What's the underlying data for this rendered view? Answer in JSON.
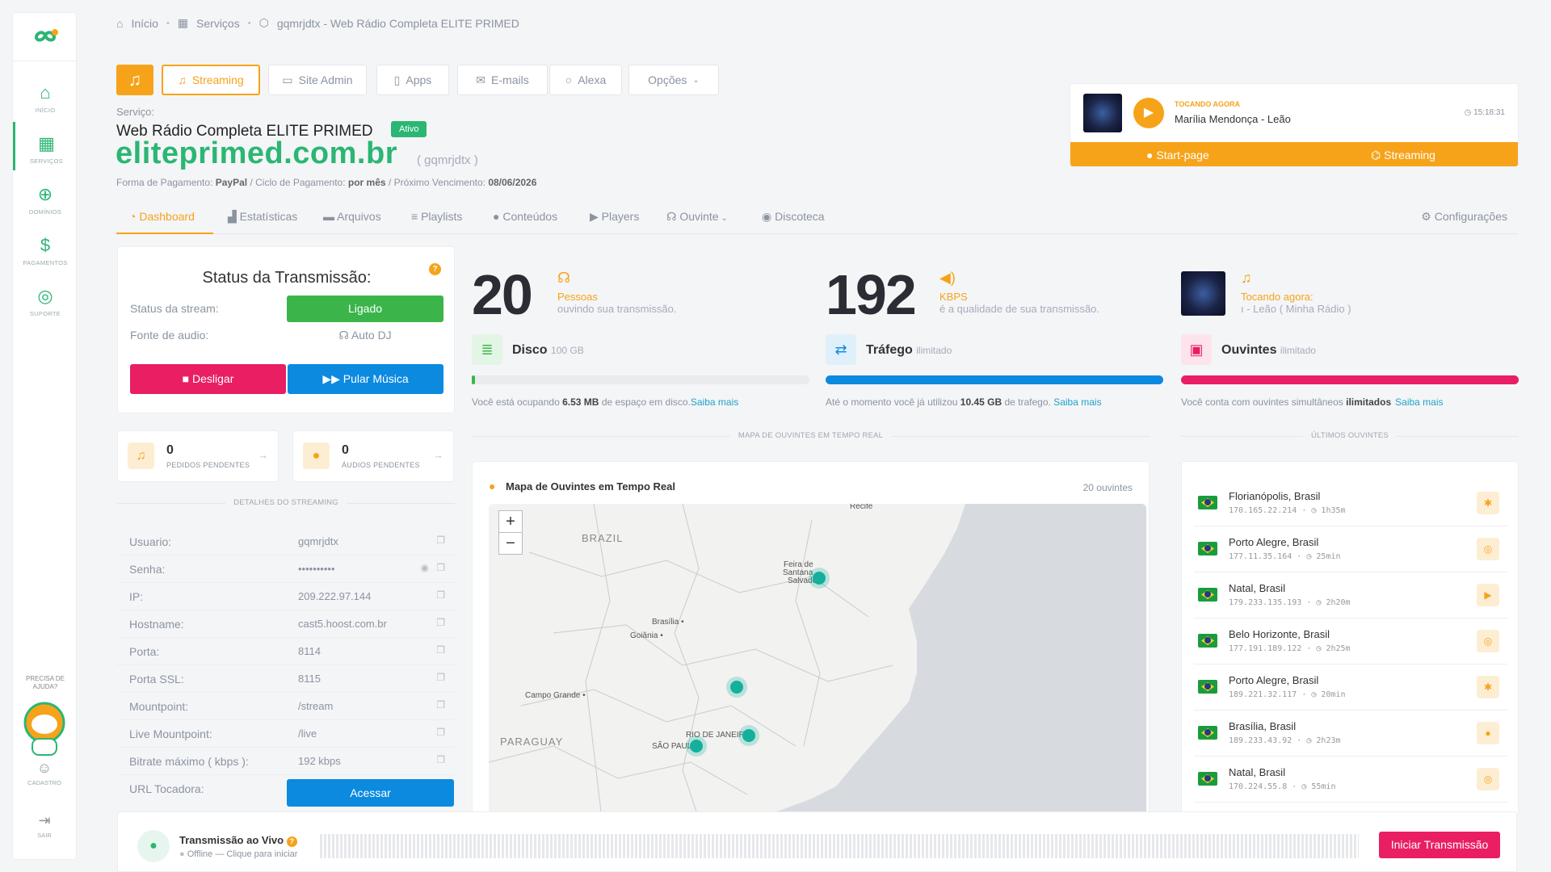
{
  "sidebar": {
    "items": [
      {
        "label": "INÍCIO",
        "icon": "home-icon"
      },
      {
        "label": "SERVIÇOS",
        "icon": "grid-icon"
      },
      {
        "label": "DOMÍNIOS",
        "icon": "globe-icon"
      },
      {
        "label": "PAGAMENTOS",
        "icon": "dollar-icon"
      },
      {
        "label": "SUPORTE",
        "icon": "lifebuoy-icon"
      }
    ],
    "help_line1": "PRECISA DE",
    "help_line2": "AJUDA?",
    "cadastro": "CADASTRO",
    "sair": "SAIR"
  },
  "breadcrumb": {
    "home": "Início",
    "services": "Serviços",
    "current": "gqmrjdtx - Web Rádio Completa ELITE PRIMED"
  },
  "toolbar": {
    "streaming": "Streaming",
    "site_admin": "Site Admin",
    "apps": "Apps",
    "emails": "E-mails",
    "alexa": "Alexa",
    "opcoes": "Opções"
  },
  "service": {
    "label": "Serviço:",
    "name": "Web Rádio Completa ELITE PRIMED",
    "status": "Ativo",
    "domain": "eliteprimed.com.br",
    "username": "( gqmrjdtx )",
    "pay_method_label": "Forma de Pagamento:",
    "pay_method": "PayPal",
    "cycle_label": "/ Ciclo de Pagamento:",
    "cycle": "por mês",
    "due_label": "/ Próximo Vencimento:",
    "due": "08/06/2026"
  },
  "now_playing": {
    "label": "TOCANDO AGORA",
    "song": "Marília Mendonça - Leão",
    "time": "15:18:31",
    "startpage": "Start-page",
    "streaming": "Streaming"
  },
  "tabs": [
    "Dashboard",
    "Estatísticas",
    "Arquivos",
    "Playlists",
    "Conteúdos",
    "Players",
    "Ouvinte",
    "Discoteca",
    "Configurações"
  ],
  "status": {
    "title": "Status da Transmissão:",
    "stream_label": "Status da stream:",
    "stream_value": "Ligado",
    "source_label": "Fonte de audio:",
    "source_value": "Auto DJ",
    "btn_off": "Desligar",
    "btn_skip": "Pular Música"
  },
  "pending": {
    "pedidos_count": "0",
    "pedidos_label": "PEDIDOS PENDENTES",
    "audios_count": "0",
    "audios_label": "ÁUDIOS PENDENTES"
  },
  "details": {
    "section_title": "DETALHES DO STREAMING",
    "rows": [
      {
        "k": "Usuario:",
        "v": "gqmrjdtx"
      },
      {
        "k": "Senha:",
        "v": "••••••••••"
      },
      {
        "k": "IP:",
        "v": "209.222.97.144"
      },
      {
        "k": "Hostname:",
        "v": "cast5.hoost.com.br"
      },
      {
        "k": "Porta:",
        "v": "8114"
      },
      {
        "k": "Porta SSL:",
        "v": "8115"
      },
      {
        "k": "Mountpoint:",
        "v": "/stream"
      },
      {
        "k": "Live Mountpoint:",
        "v": "/live"
      },
      {
        "k": "Bitrate máximo ( kbps ):",
        "v": "192 kbps"
      },
      {
        "k": "URL Tocadora:",
        "v": ""
      }
    ],
    "acessar": "Acessar"
  },
  "stats": {
    "listeners": "20",
    "listeners_label": "Pessoas",
    "listeners_sub": "ouvindo sua transmissão.",
    "bitrate": "192",
    "bitrate_label": "KBPS",
    "bitrate_sub": "é a qualidade de sua transmissão.",
    "np_label": "Tocando agora:",
    "np_sub": "ı - Leão ( Minha Rádio )"
  },
  "resources": {
    "disk_title": "Disco",
    "disk_cap": "100 GB",
    "disk_desc_pre": "Você está ocupando",
    "disk_used": "6.53 MB",
    "disk_desc_post": "de espaço em disco.",
    "traffic_title": "Tráfego",
    "traffic_cap": "ilimitado",
    "traffic_desc_pre": "Até o momento você já utilizou",
    "traffic_used": "10.45 GB",
    "traffic_desc_post": "de trafego.",
    "listeners_title": "Ouvintes",
    "listeners_cap": "ilimitado",
    "listeners_desc_pre": "Você conta com ouvintes simultâneos",
    "listeners_val": "ilimitados",
    "saiba": "Saiba mais",
    "disk_fill": 0.01,
    "traffic_fill": 1.0,
    "listeners_fill": 1.0,
    "colors": {
      "disk": "#3bb54a",
      "traffic": "#0b8ae0",
      "listeners": "#e91e63"
    }
  },
  "map": {
    "section_title": "MAPA DE OUVINTES EM TEMPO REAL",
    "title": "Mapa de Ouvintes em Tempo Real",
    "count": "20 ouvintes",
    "labels": {
      "brazil": "BRAZIL",
      "paraguay": "PARAGUAY",
      "feira": "Feira de",
      "santana": "Santana",
      "salvador": "Salvado",
      "recife": "Recife",
      "brasilia": "Brasília •",
      "goiania": "Goiânia •",
      "campo_grande": "Campo Grande •",
      "rio": "RIO DE JANEIRO",
      "sao_paulo": "SÃO PAULO"
    }
  },
  "recent": {
    "section_title": "ÚLTIMOS OUVINTES",
    "items": [
      {
        "city": "Florianópolis, Brasil",
        "ip": "170.165.22.214",
        "dur": "1h35m",
        "platform": "android-icon"
      },
      {
        "city": "Porto Alegre, Brasil",
        "ip": "177.11.35.164",
        "dur": "25min",
        "platform": "chrome-icon"
      },
      {
        "city": "Natal, Brasil",
        "ip": "179.233.135.193",
        "dur": "2h20m",
        "platform": "play-icon"
      },
      {
        "city": "Belo Horizonte, Brasil",
        "ip": "177.191.189.122",
        "dur": "2h25m",
        "platform": "chrome-icon"
      },
      {
        "city": "Porto Alegre, Brasil",
        "ip": "189.221.32.117",
        "dur": "20min",
        "platform": "android-icon"
      },
      {
        "city": "Brasília, Brasil",
        "ip": "189.233.43.92",
        "dur": "2h23m",
        "platform": "apple-icon"
      },
      {
        "city": "Natal, Brasil",
        "ip": "170.224.55.8",
        "dur": "55min",
        "platform": "chrome-icon"
      }
    ]
  },
  "live": {
    "title": "Transmissão ao Vivo",
    "status": "Offline — Clique para iniciar",
    "button": "Iniciar Transmissão"
  }
}
